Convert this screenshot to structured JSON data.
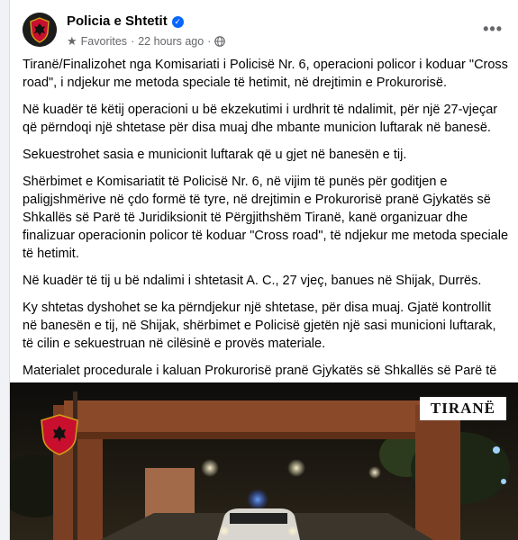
{
  "post": {
    "author": "Policia e Shtetit",
    "audience_label": "Favorites",
    "separator": "·",
    "timestamp": "22 hours ago",
    "more_icon": "•••",
    "paragraphs": [
      "Tiranë/Finalizohet nga Komisariati i Policisë Nr. 6, operacioni policor i koduar \"Cross road\", i ndjekur me metoda speciale të hetimit, në drejtimin e Prokurorisë.",
      "Në kuadër të këtij operacioni u bë ekzekutimi i urdhrit të ndalimit, për një 27-vjeçar që përndoqi një shtetase për disa muaj dhe mbante municion luftarak në banesë.",
      "Sekuestrohet sasia e municionit luftarak që u gjet në banesën e tij.",
      "Shërbimet e Komisariatit të Policisë Nr. 6, në vijim të punës për goditjen e paligjshmërive në çdo formë të tyre, në drejtimin e Prokurorisë pranë Gjykatës së Shkallës së Parë të Juridiksionit të Përgjithshëm Tiranë, kanë organizuar dhe finalizuar operacionin policor të koduar \"Cross road\", të ndjekur me metoda speciale të hetimit.",
      "Në kuadër të tij u bë ndalimi i shtetasit A. C., 27 vjeç, banues në Shijak, Durrës.",
      "Ky shtetas dyshohet se ka përndjekur një shtetase, për disa muaj. Gjatë kontrollit në banesën e  tij, në Shijak, shërbimet e Policisë gjetën një sasi municioni luftarak, të cilin e sekuestruan në cilësinë e provës materiale.",
      "Materialet procedurale i kaluan Prokurorisë pranë Gjykatës së Shkallës së Parë të Juridiksionit të Përgjithshëm Tiranë, për veprime të mëtejshme."
    ],
    "photo_watermark": "TIRANË"
  },
  "colors": {
    "accent": "#0866ff",
    "emblem_red": "#c8102e",
    "secondary_text": "#65676b"
  }
}
